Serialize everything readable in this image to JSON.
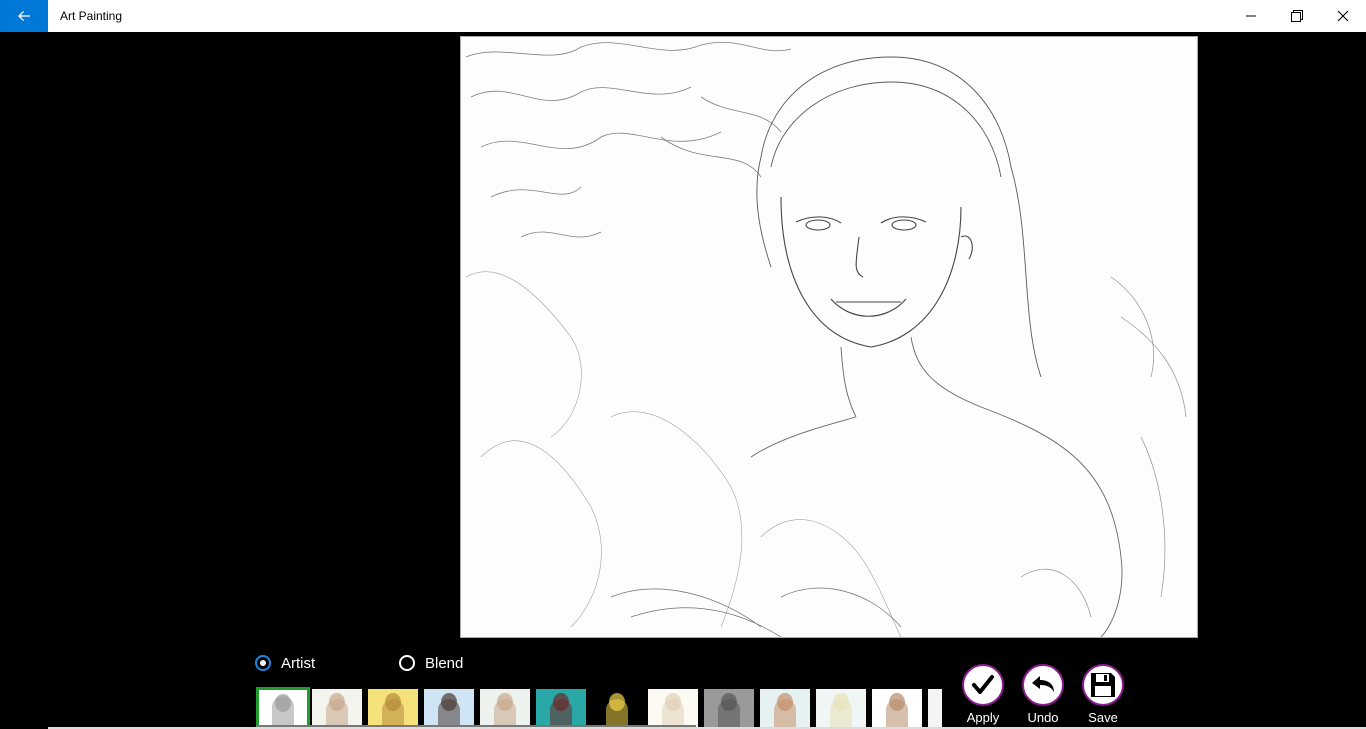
{
  "window": {
    "title": "Art Painting",
    "back_icon": "back-arrow-icon",
    "controls": [
      "minimize-icon",
      "maximize-icon",
      "close-icon"
    ]
  },
  "mode": {
    "options": [
      {
        "label": "Artist",
        "selected": true
      },
      {
        "label": "Blend",
        "selected": false
      }
    ]
  },
  "actions": {
    "apply": "Apply",
    "undo": "Undo",
    "save": "Save"
  },
  "thumbnails": [
    {
      "style": "pencil",
      "bg": "#ffffff",
      "tone": "#9a9a9a",
      "selected": true
    },
    {
      "style": "pastel",
      "bg": "#f4f4ee",
      "tone": "#c7a58a",
      "selected": false
    },
    {
      "style": "yellow",
      "bg": "#f6e27a",
      "tone": "#b58a3a",
      "selected": false
    },
    {
      "style": "ink-blue",
      "bg": "#cfe4f5",
      "tone": "#4a3a32",
      "selected": false
    },
    {
      "style": "soft",
      "bg": "#eef2ee",
      "tone": "#c7a58a",
      "selected": false
    },
    {
      "style": "teal",
      "bg": "#2aa7a7",
      "tone": "#6b2a2a",
      "selected": false
    },
    {
      "style": "pop",
      "bg": "#000000",
      "tone": "#f2d24a",
      "selected": false
    },
    {
      "style": "light",
      "bg": "#fbfbf4",
      "tone": "#e0cfb8",
      "selected": false
    },
    {
      "style": "gray",
      "bg": "#9a9a9a",
      "tone": "#555555",
      "selected": false
    },
    {
      "style": "watercolor",
      "bg": "#e6f2f2",
      "tone": "#c48f6a",
      "selected": false
    },
    {
      "style": "pale",
      "bg": "#f0f6f6",
      "tone": "#e8e2b8",
      "selected": false
    },
    {
      "style": "white",
      "bg": "#ffffff",
      "tone": "#b58a6a",
      "selected": false
    },
    {
      "style": "partial",
      "bg": "#f4f4f4",
      "tone": "#c0a080",
      "selected": false
    }
  ],
  "accent": "#0078d7",
  "action_ring_color": "#8b1c8f",
  "selected_thumb_color": "#1f9d2f"
}
